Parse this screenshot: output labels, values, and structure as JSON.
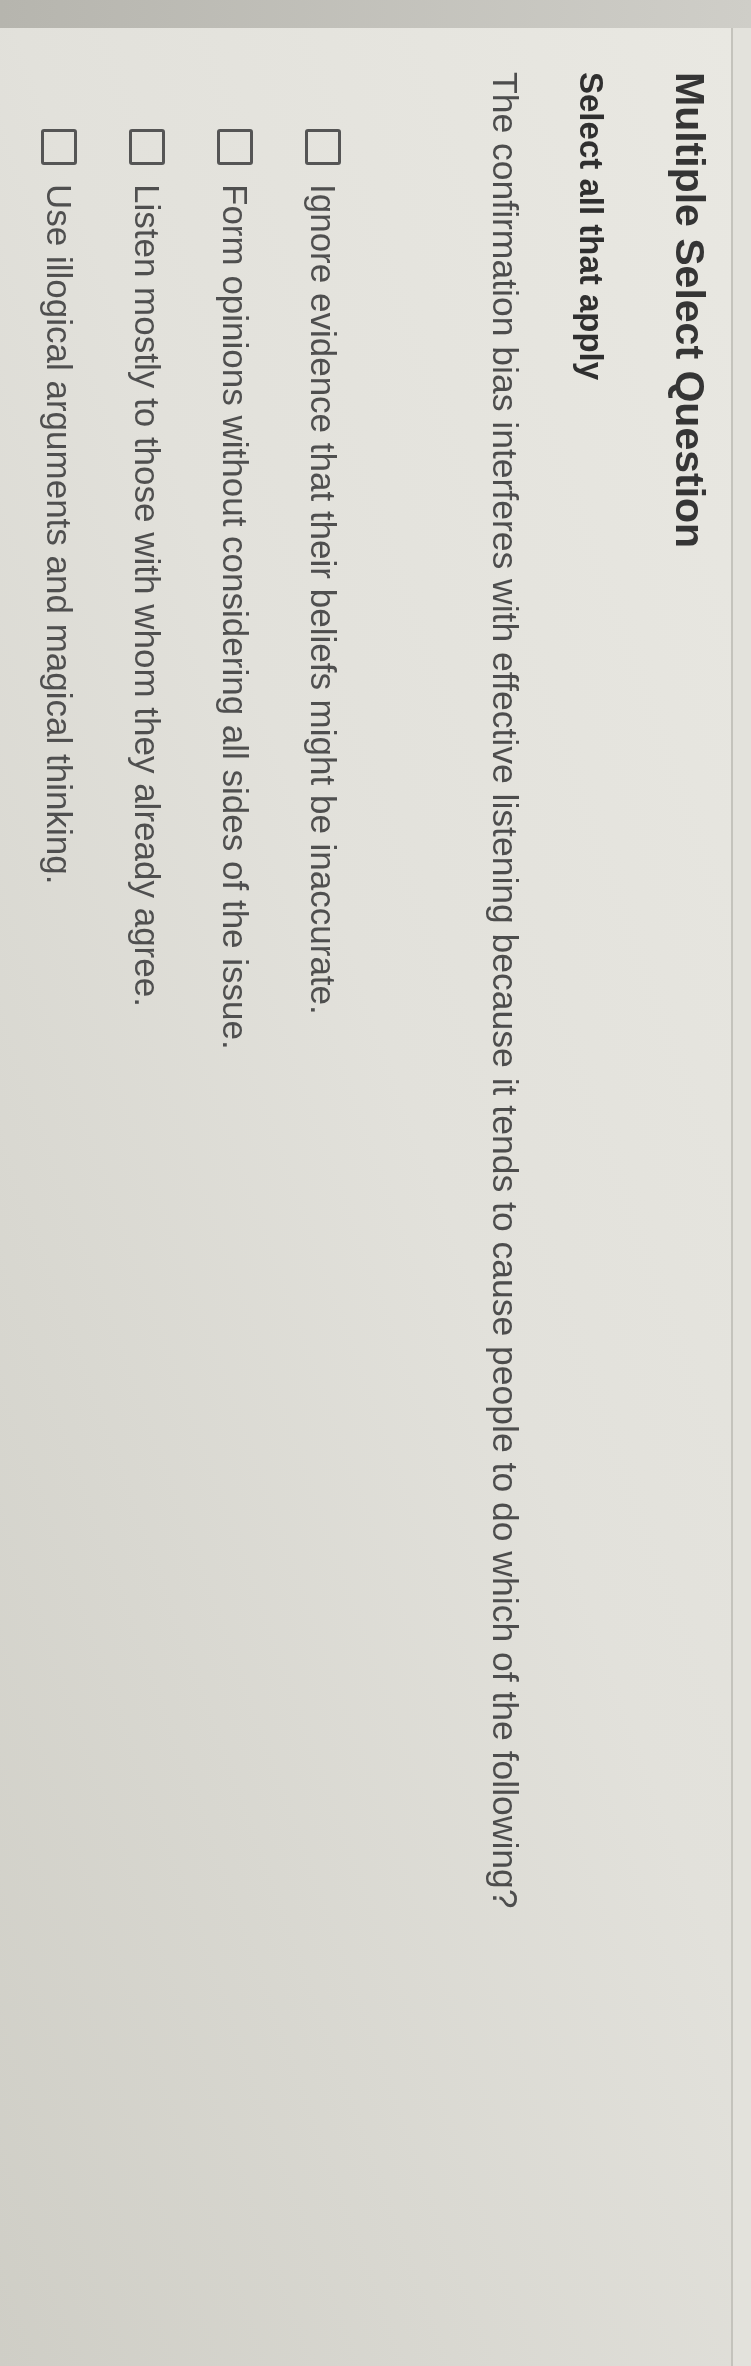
{
  "title": "Multiple Select Question",
  "instruction": "Select all that apply",
  "question": "The confirmation bias interferes with effective listening because it tends to cause people to do which of the following?",
  "options": [
    {
      "label": "Ignore evidence that their beliefs might be inaccurate.",
      "checked": false
    },
    {
      "label": "Form opinions without considering all sides of the issue.",
      "checked": false
    },
    {
      "label": "Listen mostly to those with whom they already agree.",
      "checked": false
    },
    {
      "label": "Use illogical arguments and magical thinking.",
      "checked": false
    }
  ]
}
